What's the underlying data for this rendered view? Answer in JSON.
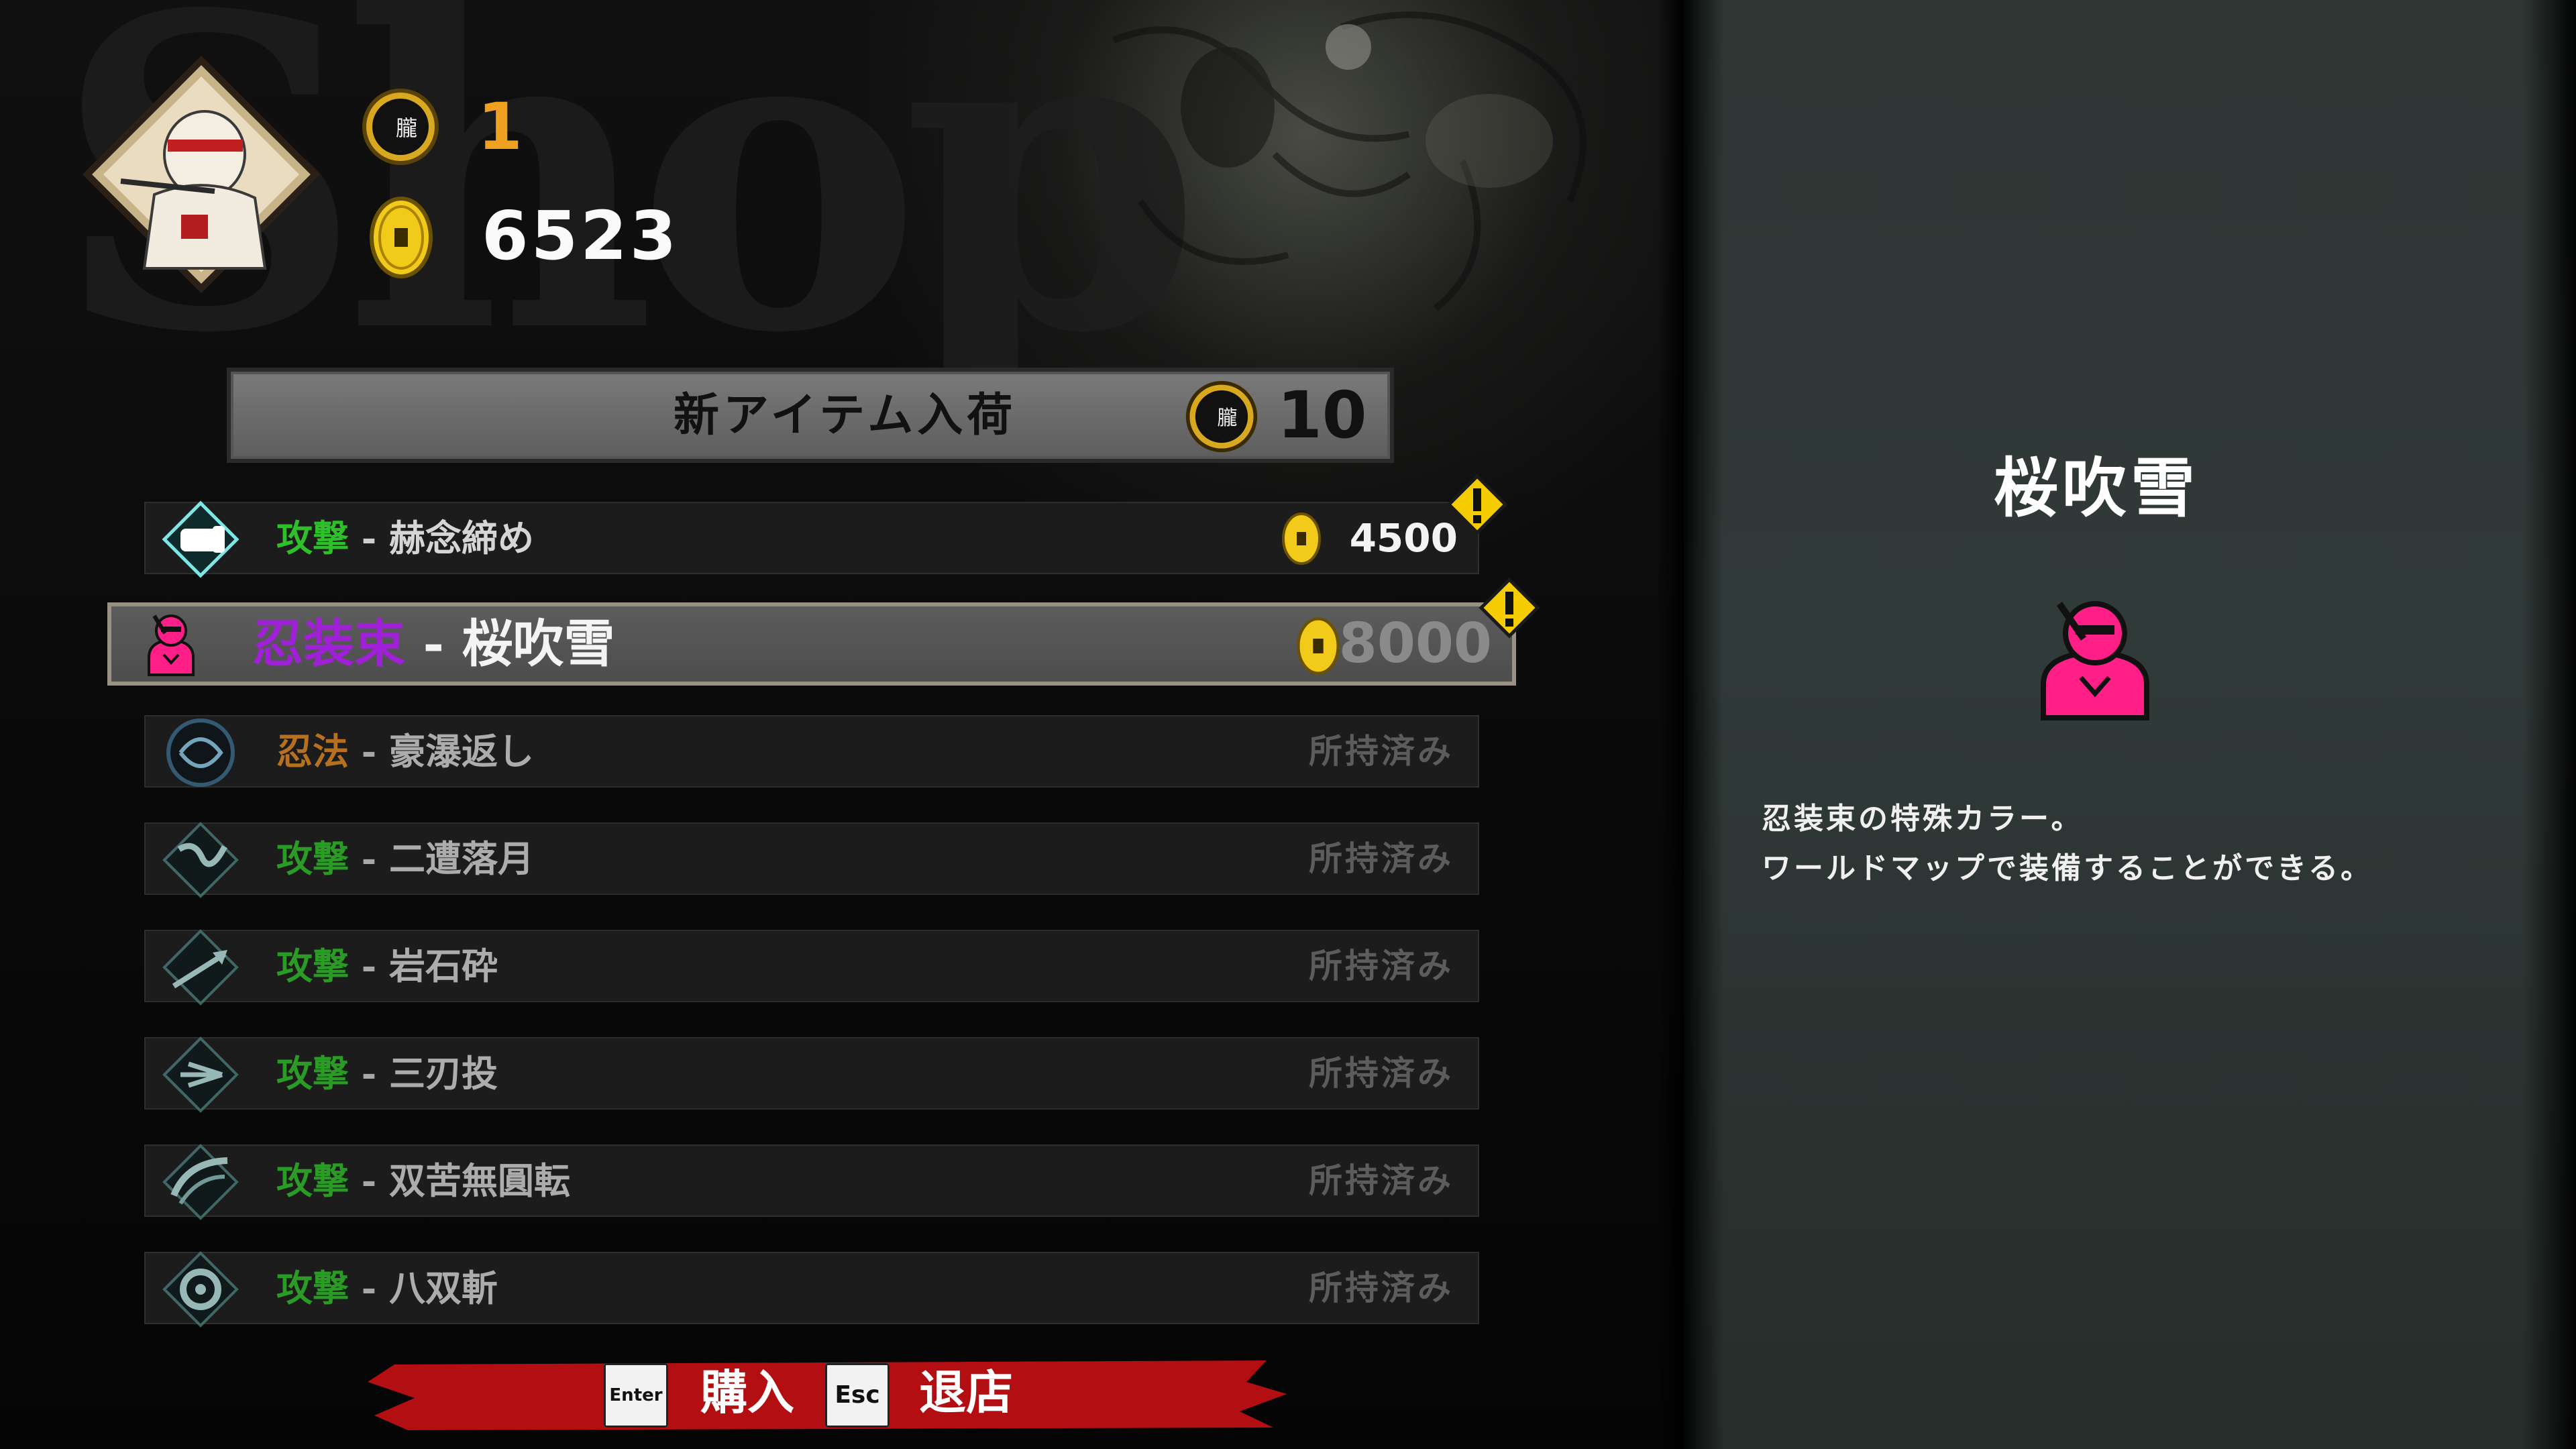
{
  "background_word": "Shop",
  "player": {
    "moon_currency": "1",
    "coin_currency": "6523"
  },
  "new_item_banner": {
    "label": "新アイテム入荷",
    "cost": "10"
  },
  "items": [
    {
      "category": "攻撃",
      "separator": " - ",
      "name": "赫念締め",
      "price": "4500",
      "status": "price",
      "alert": true,
      "icon": "fist-icon"
    },
    {
      "category": "忍装束",
      "separator": " - ",
      "name": "桜吹雪",
      "price": "8000",
      "status": "selected",
      "alert": true,
      "icon": "ninja-costume-icon"
    },
    {
      "category": "忍法",
      "separator": " - ",
      "name": "豪瀑返し",
      "status": "所持済み",
      "icon": "water-swirl-icon"
    },
    {
      "category": "攻撃",
      "separator": " - ",
      "name": "二遭落月",
      "status": "所持済み",
      "icon": "crescent-slash-icon"
    },
    {
      "category": "攻撃",
      "separator": " - ",
      "name": "岩石砕",
      "status": "所持済み",
      "icon": "arrow-strike-icon"
    },
    {
      "category": "攻撃",
      "separator": " - ",
      "name": "三刃投",
      "status": "所持済み",
      "icon": "kunai-throw-icon"
    },
    {
      "category": "攻撃",
      "separator": " - ",
      "name": "双苦無圓転",
      "status": "所持済み",
      "icon": "spin-slash-icon"
    },
    {
      "category": "攻撃",
      "separator": " - ",
      "name": "八双斬",
      "status": "所持済み",
      "icon": "ring-slash-icon"
    }
  ],
  "controls": {
    "buy_key": "Enter",
    "buy_label": "購入",
    "exit_key": "Esc",
    "exit_label": "退店"
  },
  "detail": {
    "title": "桜吹雪",
    "desc_line1": "忍装束の特殊カラー。",
    "desc_line2": "ワールドマップで装備することができる。"
  },
  "colors": {
    "attack_category": "#2ec02a",
    "ninpo_category": "#e08a20",
    "costume_category": "#a020d8",
    "costume_icon": "#ff1f86",
    "alert_yellow": "#f5cc00",
    "moon_count": "#f0a020"
  }
}
